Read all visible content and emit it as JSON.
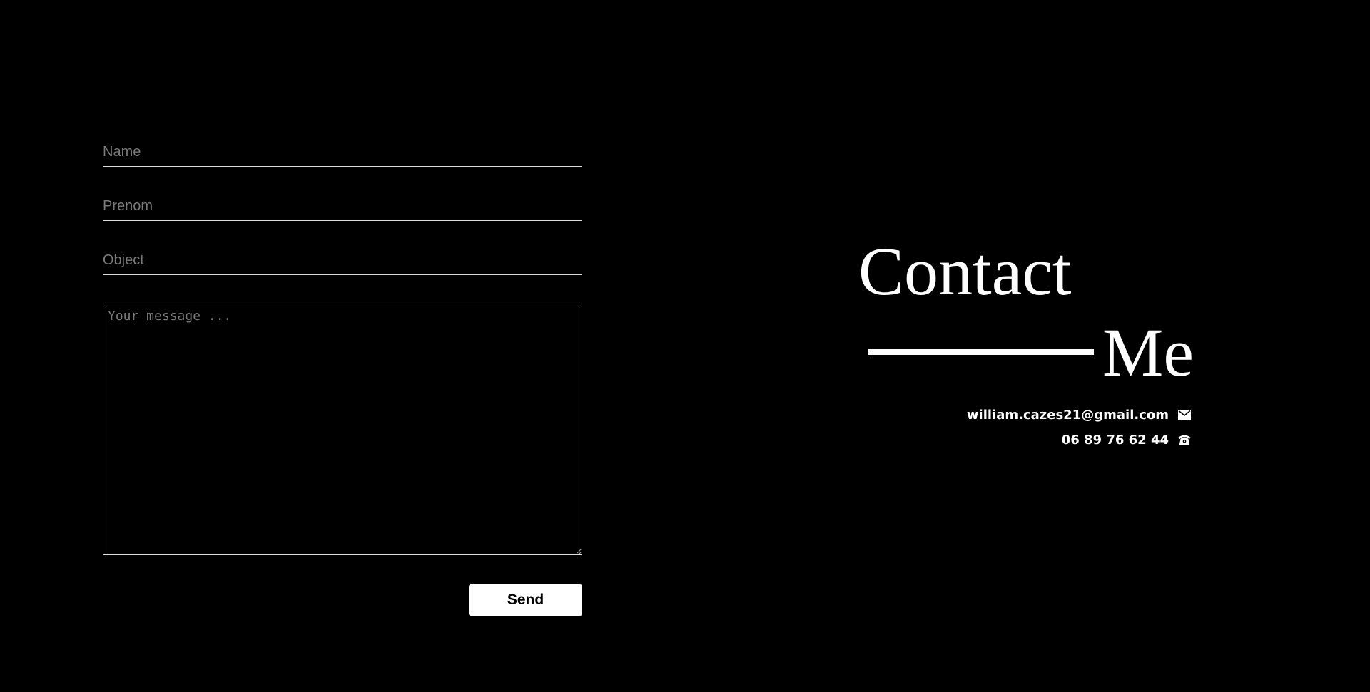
{
  "form": {
    "name_placeholder": "Name",
    "prenom_placeholder": "Prenom",
    "object_placeholder": "Object",
    "message_placeholder": "Your message ...",
    "send_label": "Send"
  },
  "heading": {
    "word1": "Contact",
    "word2": "Me"
  },
  "contact": {
    "email": "william.cazes21@gmail.com",
    "email_icon": "mail-icon",
    "phone": "06 89 76 62 44",
    "phone_icon": "phone-icon"
  },
  "colors": {
    "background": "#000000",
    "foreground": "#ffffff",
    "placeholder": "#7a7a7a",
    "field_border": "#d9d9d9"
  }
}
